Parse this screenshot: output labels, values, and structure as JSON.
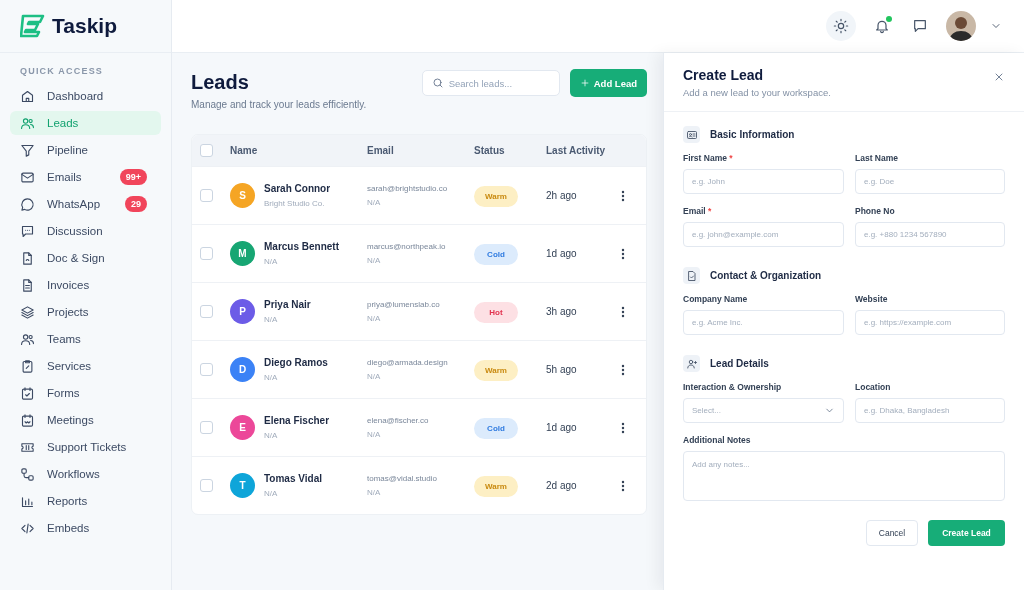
{
  "brand": {
    "name": "Taskip"
  },
  "sidebar": {
    "section": "QUICK ACCESS",
    "items": [
      {
        "label": "Dashboard",
        "selected": false
      },
      {
        "label": "Leads",
        "selected": true
      },
      {
        "label": "Pipeline",
        "selected": false
      },
      {
        "label": "Emails",
        "selected": false,
        "badge": "99+"
      },
      {
        "label": "WhatsApp",
        "selected": false,
        "badge": "29"
      },
      {
        "label": "Discussion",
        "selected": false
      },
      {
        "label": "Doc & Sign",
        "selected": false
      },
      {
        "label": "Invoices",
        "selected": false
      },
      {
        "label": "Projects",
        "selected": false
      },
      {
        "label": "Teams",
        "selected": false
      },
      {
        "label": "Services",
        "selected": false
      },
      {
        "label": "Forms",
        "selected": false
      },
      {
        "label": "Meetings",
        "selected": false
      },
      {
        "label": "Support Tickets",
        "selected": false
      },
      {
        "label": "Workflows",
        "selected": false
      },
      {
        "label": "Reports",
        "selected": false
      },
      {
        "label": "Embeds",
        "selected": false
      }
    ]
  },
  "topbar": {
    "notifications_unread": true
  },
  "page": {
    "title": "Leads",
    "subtitle": "Manage and track your leads efficiently.",
    "search": {
      "placeholder": "Search leads..."
    },
    "add_button": "Add Lead"
  },
  "table": {
    "header_checked": false,
    "columns": [
      "Name",
      "Email",
      "Status",
      "Last Activity"
    ],
    "rows": [
      {
        "checked": false,
        "initial": "S",
        "color": "#f5a524",
        "name": "Sarah Connor",
        "company": "Bright Studio Co.",
        "email": "sarah@brightstudio.co",
        "email_note": "N/A",
        "status": {
          "label": "Warm",
          "kind": "warm"
        },
        "activity": "2h ago"
      },
      {
        "checked": false,
        "initial": "M",
        "color": "#17a673",
        "name": "Marcus Bennett",
        "company": "N/A",
        "email": "marcus@northpeak.io",
        "email_note": "N/A",
        "status": {
          "label": "Cold",
          "kind": "cold"
        },
        "activity": "1d ago"
      },
      {
        "checked": false,
        "initial": "P",
        "color": "#6c5ce7",
        "name": "Priya Nair",
        "company": "N/A",
        "email": "priya@lumenslab.co",
        "email_note": "N/A",
        "status": {
          "label": "Hot",
          "kind": "hot"
        },
        "activity": "3h ago"
      },
      {
        "checked": false,
        "initial": "D",
        "color": "#3b82f6",
        "name": "Diego Ramos",
        "company": "N/A",
        "email": "diego@armada.design",
        "email_note": "N/A",
        "status": {
          "label": "Warm",
          "kind": "warm"
        },
        "activity": "5h ago"
      },
      {
        "checked": false,
        "initial": "E",
        "color": "#ec4899",
        "name": "Elena Fischer",
        "company": "N/A",
        "email": "elena@fischer.co",
        "email_note": "N/A",
        "status": {
          "label": "Cold",
          "kind": "cold"
        },
        "activity": "1d ago"
      },
      {
        "checked": false,
        "initial": "T",
        "color": "#0ea5d9",
        "name": "Tomas Vidal",
        "company": "N/A",
        "email": "tomas@vidal.studio",
        "email_note": "N/A",
        "status": {
          "label": "Warm",
          "kind": "warm"
        },
        "activity": "2d ago"
      }
    ]
  },
  "panel": {
    "title": "Create Lead",
    "subtitle": "Add a new lead to your workspace.",
    "sections": [
      {
        "title": "Basic Information",
        "fields": [
          {
            "kind": "input",
            "label": "First Name",
            "required": true,
            "placeholder": "e.g. John"
          },
          {
            "kind": "input",
            "label": "Last Name",
            "required": false,
            "placeholder": "e.g. Doe"
          },
          {
            "kind": "input",
            "label": "Email",
            "required": true,
            "placeholder": "e.g. john@example.com"
          },
          {
            "kind": "input",
            "label": "Phone No",
            "required": false,
            "placeholder": "e.g. +880 1234 567890"
          }
        ]
      },
      {
        "title": "Contact & Organization",
        "fields": [
          {
            "kind": "input",
            "label": "Company Name",
            "required": false,
            "placeholder": "e.g. Acme Inc."
          },
          {
            "kind": "input",
            "label": "Website",
            "required": false,
            "placeholder": "e.g. https://example.com"
          }
        ]
      },
      {
        "title": "Lead Details",
        "fields": [
          {
            "kind": "select",
            "label": "Interaction & Ownership",
            "required": false,
            "placeholder": "Select..."
          },
          {
            "kind": "input",
            "label": "Location",
            "required": false,
            "placeholder": "e.g. Dhaka, Bangladesh"
          },
          {
            "kind": "textarea",
            "label": "Additional Notes",
            "required": false,
            "placeholder": "Add any notes..."
          }
        ]
      }
    ],
    "required_mark": "*",
    "cancel_button": "Cancel",
    "submit_button": "Create Lead"
  }
}
